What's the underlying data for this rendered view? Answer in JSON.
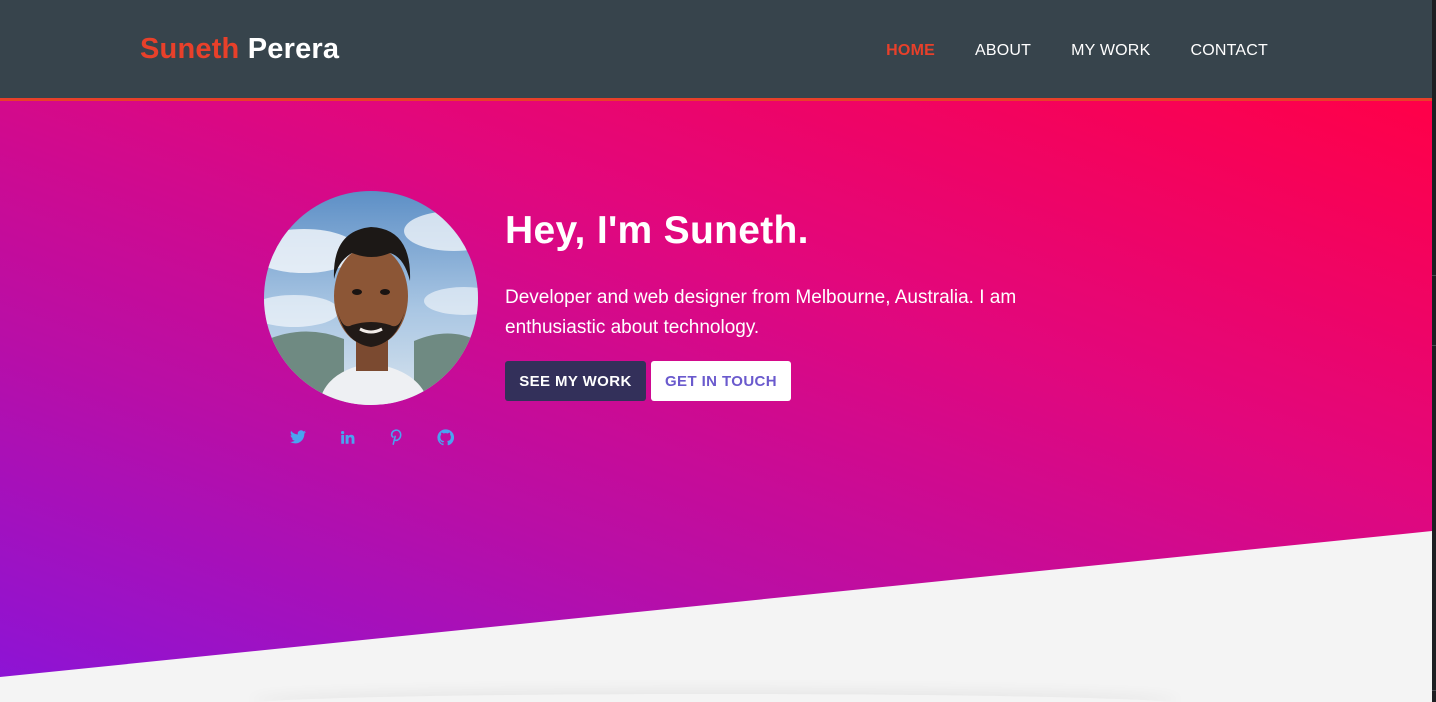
{
  "brand": {
    "first_name": "Suneth",
    "last_name": "Perera"
  },
  "nav": {
    "items": [
      {
        "label": "HOME",
        "active": true
      },
      {
        "label": "ABOUT",
        "active": false
      },
      {
        "label": "MY WORK",
        "active": false
      },
      {
        "label": "CONTACT",
        "active": false
      }
    ]
  },
  "hero": {
    "title": "Hey, I'm Suneth.",
    "description": "Developer and web designer from Melbourne, Australia. I am enthusiastic about technology.",
    "primary_button": "SEE MY WORK",
    "secondary_button": "GET IN TOUCH"
  },
  "socials": [
    "twitter-icon",
    "linkedin-icon",
    "pinterest-icon",
    "github-icon"
  ],
  "colors": {
    "nav_background": "#37444c",
    "accent": "#e8402a",
    "gradient_start": "#8a14d8",
    "gradient_end": "#ff0048",
    "social_icon": "#4aa3f0",
    "primary_button": "#33305a",
    "secondary_button_text": "#6a5acd",
    "page_background": "#f4f4f4"
  }
}
